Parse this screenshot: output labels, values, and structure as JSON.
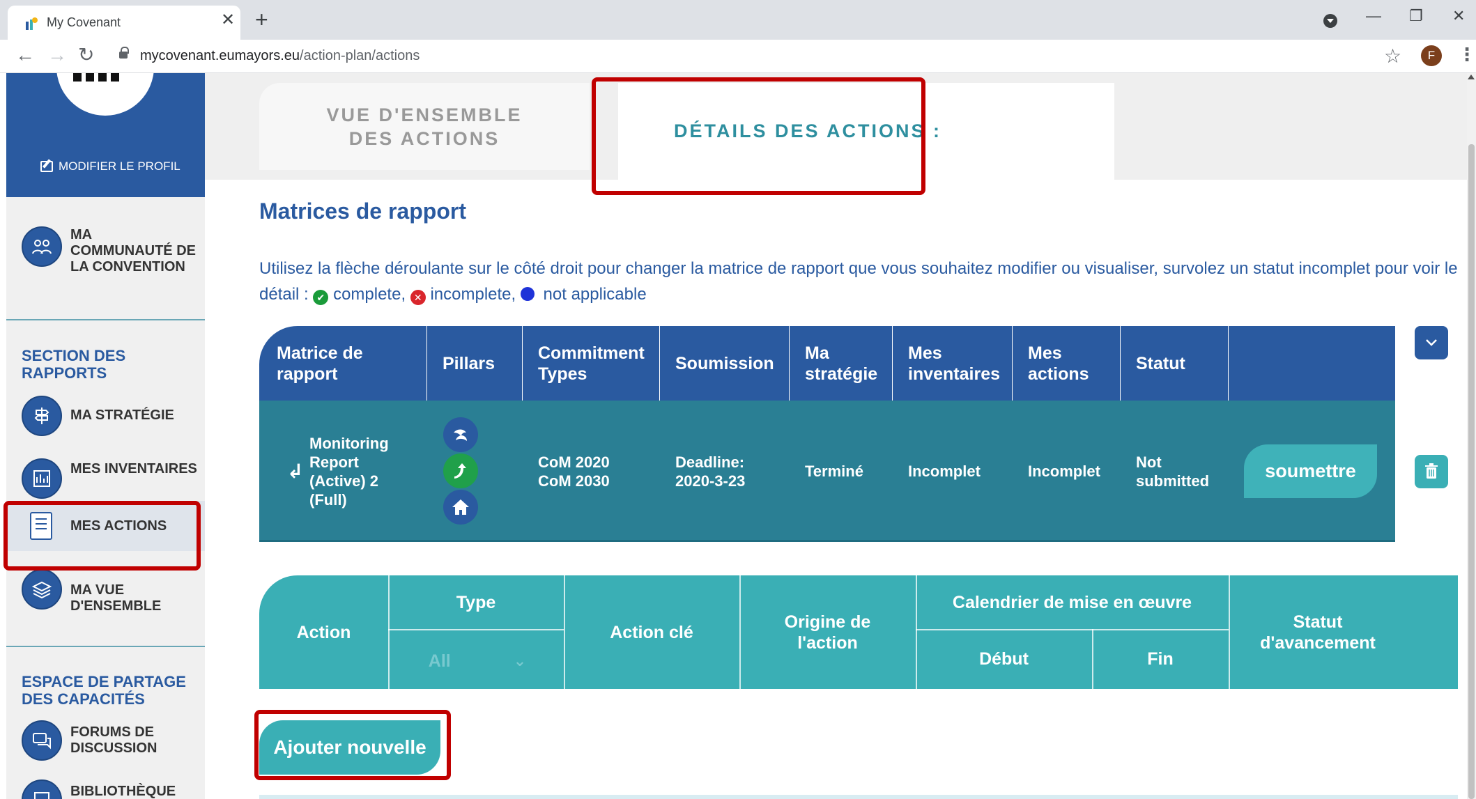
{
  "browser": {
    "tab_title": "My Covenant",
    "tab_close": "✕",
    "new_tab": "+",
    "url_host": "mycovenant.eumayors.eu",
    "url_path": "/action-plan/actions",
    "profile_initial": "F",
    "back": "←",
    "forward": "→",
    "reload": "↻",
    "bookmark": "☆",
    "menu": "⋮",
    "minimize": "—",
    "restore": "❐",
    "close": "✕"
  },
  "sidebar": {
    "edit_profile": "MODIFIER LE PROFIL",
    "community": "MA COMMUNAUTÉ DE LA CONVENTION",
    "section_reports": "SECTION DES RAPPORTS",
    "strategy": "MA STRATÉGIE",
    "inventories": "MES INVENTAIRES",
    "actions": "MES ACTIONS",
    "overview": "MA VUE D'ENSEMBLE",
    "section_capacity": "ESPACE DE PARTAGE DES CAPACITÉS",
    "forums": "FORUMS DE DISCUSSION",
    "library": "BIBLIOTHÈQUE"
  },
  "tabs": {
    "overview": "VUE D'ENSEMBLE DES ACTIONS",
    "details": "DÉTAILS DES ACTIONS :"
  },
  "main": {
    "heading": "Matrices de rapport",
    "instruction": "Utilisez la flèche déroulante sur le côté droit pour changer la matrice de rapport que vous souhaitez modifier ou visualiser, survolez un statut incomplet pour voir le détail :",
    "legend_complete": "complete,",
    "legend_incomplete": "incomplete,",
    "legend_na": "not applicable"
  },
  "report_table": {
    "headers": [
      "Matrice de rapport",
      "Pillars",
      "Commitment Types",
      "Soumission",
      "Ma stratégie",
      "Mes inventaires",
      "Mes actions",
      "Statut"
    ],
    "row": {
      "arrow": "↲",
      "name": "Monitoring Report (Active) 2 (Full)",
      "commitment": "CoM 2020 CoM 2030",
      "deadline": "Deadline: 2020-3-23",
      "strategy": "Terminé",
      "inventories": "Incomplet",
      "actions": "Incomplet",
      "status": "Not submitted",
      "submit": "soumettre"
    }
  },
  "action_table": {
    "action": "Action",
    "type": "Type",
    "type_filter": "All",
    "type_chevron": "⌄",
    "key_action": "Action clé",
    "origin": "Origine de l'action",
    "calendar": "Calendrier de mise en œuvre",
    "start": "Début",
    "end": "Fin",
    "progress": "Statut d'avancement"
  },
  "add_button": "Ajouter nouvelle",
  "colors": {
    "brand_blue": "#2a5aa0",
    "teal": "#3aafb5",
    "row_teal": "#2a7f94",
    "highlight_red": "#c00000"
  }
}
